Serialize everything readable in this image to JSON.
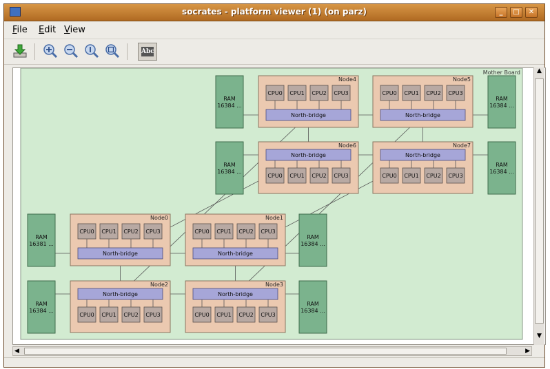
{
  "window": {
    "title": "socrates - platform viewer (1)  (on parz)"
  },
  "menu": {
    "file_first": "F",
    "file_rest": "ile",
    "edit_first": "E",
    "edit_rest": "dit",
    "view_first": "V",
    "view_rest": "iew"
  },
  "toolbar": {
    "text_toggle_label": "Abc"
  },
  "diagram": {
    "board_label": "Mother Board",
    "node_labels": [
      "Node0",
      "Node1",
      "Node2",
      "Node3",
      "Node4",
      "Node5",
      "Node6",
      "Node7"
    ],
    "cpu_labels": [
      "CPU0",
      "CPU1",
      "CPU2",
      "CPU3"
    ],
    "northbridge_label": "North-bridge",
    "ram_label": "RAM",
    "ram_sizes": [
      "16381 ...",
      "16384 ...",
      "16384 ...",
      "16384 ...",
      "16384 ...",
      "16384 ...",
      "16384 ...",
      "16384 ..."
    ]
  },
  "colors": {
    "board": "#d2ebd1",
    "node": "#ebc9b0",
    "cpu": "#b8a9a3",
    "northbridge": "#a6a6d8",
    "ram": "#7bb38d",
    "titlebar": "#c98230"
  }
}
